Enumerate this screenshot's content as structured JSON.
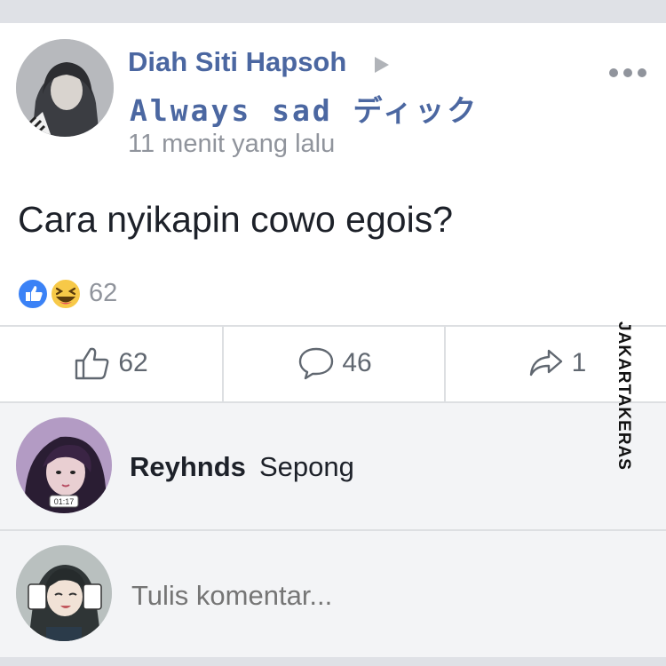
{
  "post": {
    "author": "Diah Siti Hapsoh",
    "status": "Always sad ディック",
    "timestamp": "11 menit yang lalu",
    "text": "Cara nyikapin cowo egois?",
    "reactions_count": "62"
  },
  "actions": {
    "like_count": "62",
    "comment_count": "46",
    "share_count": "1"
  },
  "comment": {
    "author": "Reyhnds",
    "text": "Sepong",
    "avatar_badge": "01:17"
  },
  "composer": {
    "placeholder": "Tulis komentar..."
  },
  "watermark": "JAKARTAKERAS",
  "colors": {
    "name_blue": "#4b67a1",
    "secondary_text": "#90949c",
    "like_blue": "#3b82f6",
    "haha_yellow": "#f7c948"
  },
  "icons": [
    "avatar",
    "play-icon",
    "more-icon",
    "like-reaction-icon",
    "haha-reaction-icon",
    "thumbs-up-icon",
    "comment-icon",
    "share-icon"
  ]
}
